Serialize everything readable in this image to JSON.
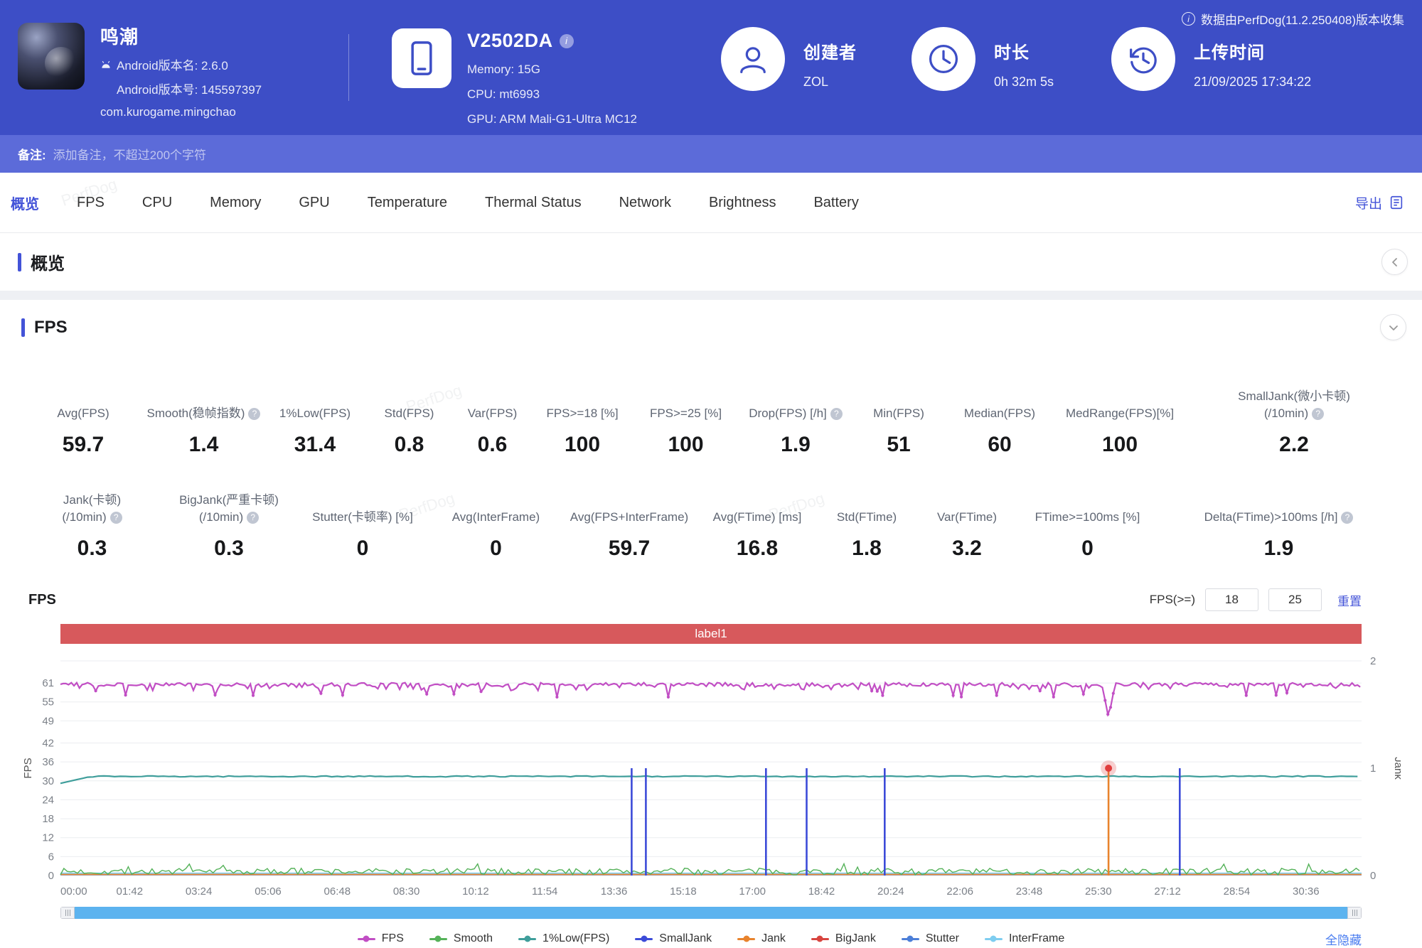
{
  "header": {
    "data_source_note": "数据由PerfDog(11.2.250408)版本收集",
    "app": {
      "name": "鸣潮",
      "android_version": "Android版本名: 2.6.0",
      "android_build": "Android版本号: 145597397",
      "package": "com.kurogame.mingchao"
    },
    "device": {
      "model": "V2502DA",
      "memory": "Memory: 15G",
      "cpu": "CPU: mt6993",
      "gpu": "GPU: ARM Mali-G1-Ultra MC12"
    },
    "creator": {
      "label": "创建者",
      "value": "ZOL"
    },
    "duration": {
      "label": "时长",
      "value": "0h 32m 5s"
    },
    "upload_time": {
      "label": "上传时间",
      "value": "21/09/2025 17:34:22"
    }
  },
  "note_bar": {
    "label": "备注:",
    "placeholder": "添加备注，不超过200个字符"
  },
  "tab_bar": {
    "tabs": [
      "概览",
      "FPS",
      "CPU",
      "Memory",
      "GPU",
      "Temperature",
      "Thermal Status",
      "Network",
      "Brightness",
      "Battery"
    ],
    "active_tab": "概览",
    "export_label": "导出"
  },
  "overview_section": {
    "title": "概览"
  },
  "fps_section": {
    "title": "FPS",
    "stats_row1": [
      {
        "label": "Avg(FPS)",
        "value": "59.7"
      },
      {
        "label": "Smooth(稳帧指数)",
        "value": "1.4",
        "help": true
      },
      {
        "label": "1%Low(FPS)",
        "value": "31.4"
      },
      {
        "label": "Std(FPS)",
        "value": "0.8"
      },
      {
        "label": "Var(FPS)",
        "value": "0.6"
      },
      {
        "label": "FPS>=18 [%]",
        "value": "100"
      },
      {
        "label": "FPS>=25 [%]",
        "value": "100"
      },
      {
        "label": "Drop(FPS) [/h]",
        "value": "1.9",
        "help": true
      },
      {
        "label": "Min(FPS)",
        "value": "51"
      },
      {
        "label": "Median(FPS)",
        "value": "60"
      },
      {
        "label": "MedRange(FPS)[%]",
        "value": "100"
      },
      {
        "label": "SmallJank(微小卡顿)",
        "label2": "(/10min)",
        "value": "2.2",
        "help": true
      }
    ],
    "stats_row2": [
      {
        "label": "Jank(卡顿)",
        "label2": "(/10min)",
        "value": "0.3",
        "help": true
      },
      {
        "label": "BigJank(严重卡顿)",
        "label2": "(/10min)",
        "value": "0.3",
        "help": true
      },
      {
        "label": "Stutter(卡顿率) [%]",
        "value": "0"
      },
      {
        "label": "Avg(InterFrame)",
        "value": "0"
      },
      {
        "label": "Avg(FPS+InterFrame)",
        "value": "59.7"
      },
      {
        "label": "Avg(FTime) [ms]",
        "value": "16.8"
      },
      {
        "label": "Std(FTime)",
        "value": "1.8"
      },
      {
        "label": "Var(FTime)",
        "value": "3.2"
      },
      {
        "label": "FTime>=100ms [%]",
        "value": "0"
      },
      {
        "label": "Delta(FTime)>100ms [/h]",
        "value": "1.9",
        "help": true
      }
    ],
    "chart_header": {
      "panel_label": "FPS",
      "threshold_label": "FPS(>=)",
      "threshold_low": "18",
      "threshold_high": "25",
      "reset_label": "重置"
    },
    "region_label": "label1",
    "hide_all_label": "全隐藏"
  },
  "watermark": "PerfDog",
  "colors": {
    "header_blue": "#3d4ec6",
    "note_bar_blue": "#5c6bd9",
    "accent_blue": "#4353d8",
    "label_bar_red": "#d7595c",
    "scrollbar_blue": "#5cb3ef"
  },
  "chart_data": {
    "type": "line",
    "title": "FPS",
    "x": {
      "tick_labels": [
        "00:00",
        "01:42",
        "03:24",
        "05:06",
        "06:48",
        "08:30",
        "10:12",
        "11:54",
        "13:36",
        "15:18",
        "17:00",
        "18:42",
        "20:24",
        "22:06",
        "23:48",
        "25:30",
        "27:12",
        "28:54",
        "30:36"
      ],
      "tick_interval_s": 102,
      "t_max_s": 1918
    },
    "y_left": {
      "label": "FPS",
      "ticks": [
        0,
        6,
        12,
        18,
        24,
        30,
        36,
        42,
        49,
        55,
        61
      ],
      "top_value": 68
    },
    "y_right": {
      "label": "Jank",
      "ticks": [
        0,
        1,
        2
      ],
      "top_value": 2
    },
    "series": [
      {
        "name": "FPS",
        "color": "#c14ec4",
        "kind": "noisy-line",
        "base": 60.2,
        "min_seen": 51,
        "max_seen": 61,
        "dip": {
          "t_s": 1545,
          "value": 50
        }
      },
      {
        "name": "Smooth",
        "color": "#55b259",
        "kind": "noisy-line",
        "base": 1.2,
        "range": [
          0,
          4
        ]
      },
      {
        "name": "1%Low(FPS)",
        "color": "#3f9e9b",
        "kind": "flat-line",
        "value": 31.4,
        "ramp_from": 29.2
      },
      {
        "name": "SmallJank",
        "color": "#3c4bd8",
        "kind": "events",
        "axis": "right",
        "value": 1,
        "times_s": [
          842,
          863,
          1040,
          1100,
          1215,
          1650
        ]
      },
      {
        "name": "Jank",
        "color": "#e8832d",
        "kind": "events",
        "axis": "right",
        "value": 1,
        "times_s": [
          1545
        ],
        "highlight_marker": true,
        "baseline": 0
      },
      {
        "name": "BigJank",
        "color": "#d8453f",
        "kind": "events",
        "axis": "right",
        "value": 1,
        "times_s": []
      },
      {
        "name": "Stutter",
        "color": "#4c7fd8",
        "kind": "flat-line",
        "value": 0
      },
      {
        "name": "InterFrame",
        "color": "#7ecdf0",
        "kind": "flat-line",
        "value": 0.5
      }
    ]
  }
}
